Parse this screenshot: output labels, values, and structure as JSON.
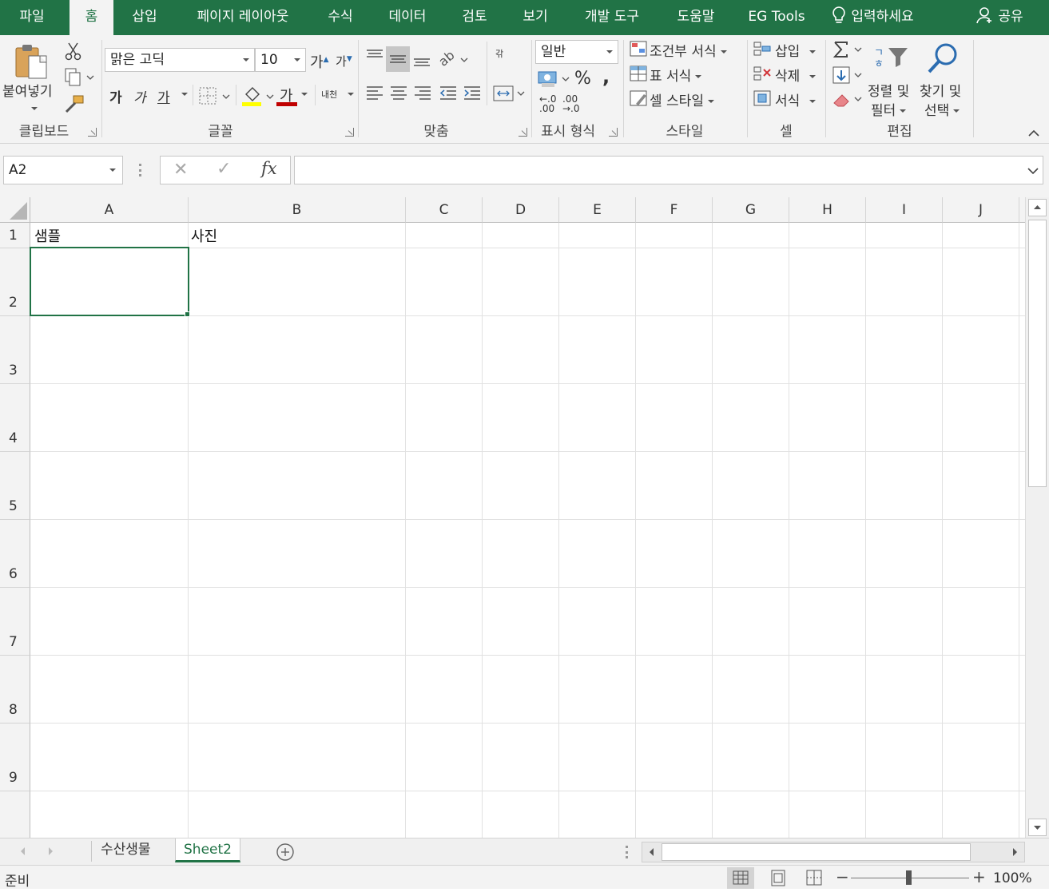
{
  "tabs": [
    "파일",
    "홈",
    "삽입",
    "페이지 레이아웃",
    "수식",
    "데이터",
    "검토",
    "보기",
    "개발 도구",
    "도움말",
    "EG Tools"
  ],
  "active_tab": "홈",
  "tell_me": "입력하세요",
  "share": "공유",
  "ribbon": {
    "clipboard": {
      "paste": "붙여넣기",
      "label": "클립보드"
    },
    "font": {
      "name": "맑은 고딕",
      "size": "10",
      "grow": "가",
      "shrink": "가",
      "bold": "가",
      "italic": "가",
      "underline": "가",
      "font_color": "가",
      "phonetic": "내천",
      "label": "글꼴"
    },
    "alignment": {
      "wrap": "갂",
      "label": "맞춤"
    },
    "number": {
      "format": "일반",
      "percent": "%",
      "comma": ",",
      "inc_decimal": "←.0 .00",
      "dec_decimal": ".00 →.0",
      "label": "표시 형식"
    },
    "styles": {
      "conditional": "조건부 서식",
      "table": "표 서식",
      "cell": "셀 스타일",
      "label": "스타일"
    },
    "cells": {
      "insert": "삽입",
      "delete": "삭제",
      "format": "서식",
      "label": "셀"
    },
    "editing": {
      "sort_filter_1": "정렬 및",
      "sort_filter_2": "필터",
      "find_select_1": "찾기 및",
      "find_select_2": "선택",
      "label": "편집"
    }
  },
  "formula_bar": {
    "name_box": "A2",
    "cancel": "✕",
    "enter": "✓",
    "fx": "fx",
    "content": ""
  },
  "columns": [
    "A",
    "B",
    "C",
    "D",
    "E",
    "F",
    "G",
    "H",
    "I",
    "J"
  ],
  "rows": [
    "1",
    "2",
    "3",
    "4",
    "5",
    "6",
    "7",
    "8",
    "9"
  ],
  "cells": {
    "A1": "샘플",
    "B1": "사진"
  },
  "sheets": [
    "수산생물",
    "Sheet2"
  ],
  "active_sheet": "Sheet2",
  "status": {
    "ready": "준비",
    "zoom": "100%"
  },
  "colors": {
    "accent": "#217346",
    "ribbon_bg": "#f3f3f3",
    "font_color_bar": "#c00000",
    "highlight_bar": "#ffff00"
  }
}
